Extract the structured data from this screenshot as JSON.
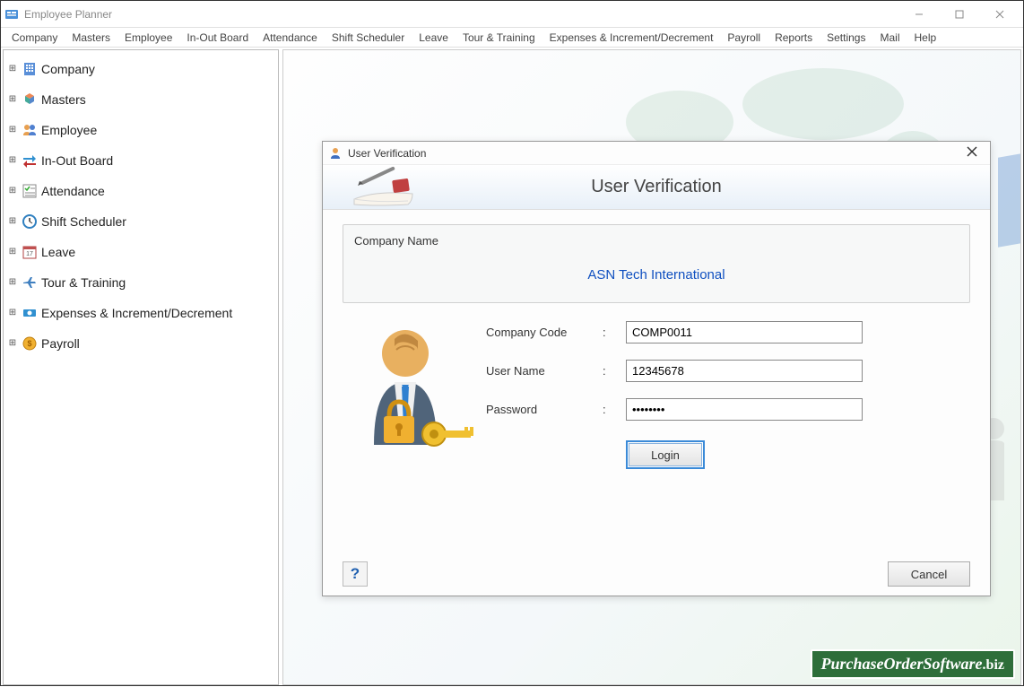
{
  "window": {
    "title": "Employee Planner"
  },
  "menubar": {
    "items": [
      "Company",
      "Masters",
      "Employee",
      "In-Out Board",
      "Attendance",
      "Shift Scheduler",
      "Leave",
      "Tour & Training",
      "Expenses & Increment/Decrement",
      "Payroll",
      "Reports",
      "Settings",
      "Mail",
      "Help"
    ]
  },
  "sidebar": {
    "items": [
      {
        "label": "Company",
        "icon": "building-icon"
      },
      {
        "label": "Masters",
        "icon": "cubes-icon"
      },
      {
        "label": "Employee",
        "icon": "people-icon"
      },
      {
        "label": "In-Out Board",
        "icon": "arrows-icon"
      },
      {
        "label": "Attendance",
        "icon": "checklist-icon"
      },
      {
        "label": "Shift Scheduler",
        "icon": "clock-icon"
      },
      {
        "label": "Leave",
        "icon": "calendar-icon"
      },
      {
        "label": "Tour & Training",
        "icon": "plane-icon"
      },
      {
        "label": "Expenses & Increment/Decrement",
        "icon": "money-icon"
      },
      {
        "label": "Payroll",
        "icon": "coin-icon"
      }
    ]
  },
  "dialog": {
    "titlebar": "User Verification",
    "header_title": "User Verification",
    "company_name_label": "Company Name",
    "company_name_value": "ASN Tech International",
    "company_code_label": "Company Code",
    "company_code_value": "COMP0011",
    "username_label": "User Name",
    "username_value": "12345678",
    "password_label": "Password",
    "password_value": "••••••••",
    "login_label": "Login",
    "cancel_label": "Cancel",
    "help_label": "?"
  },
  "watermark": {
    "main": "PurchaseOrderSoftware",
    "suffix": ".biz"
  }
}
